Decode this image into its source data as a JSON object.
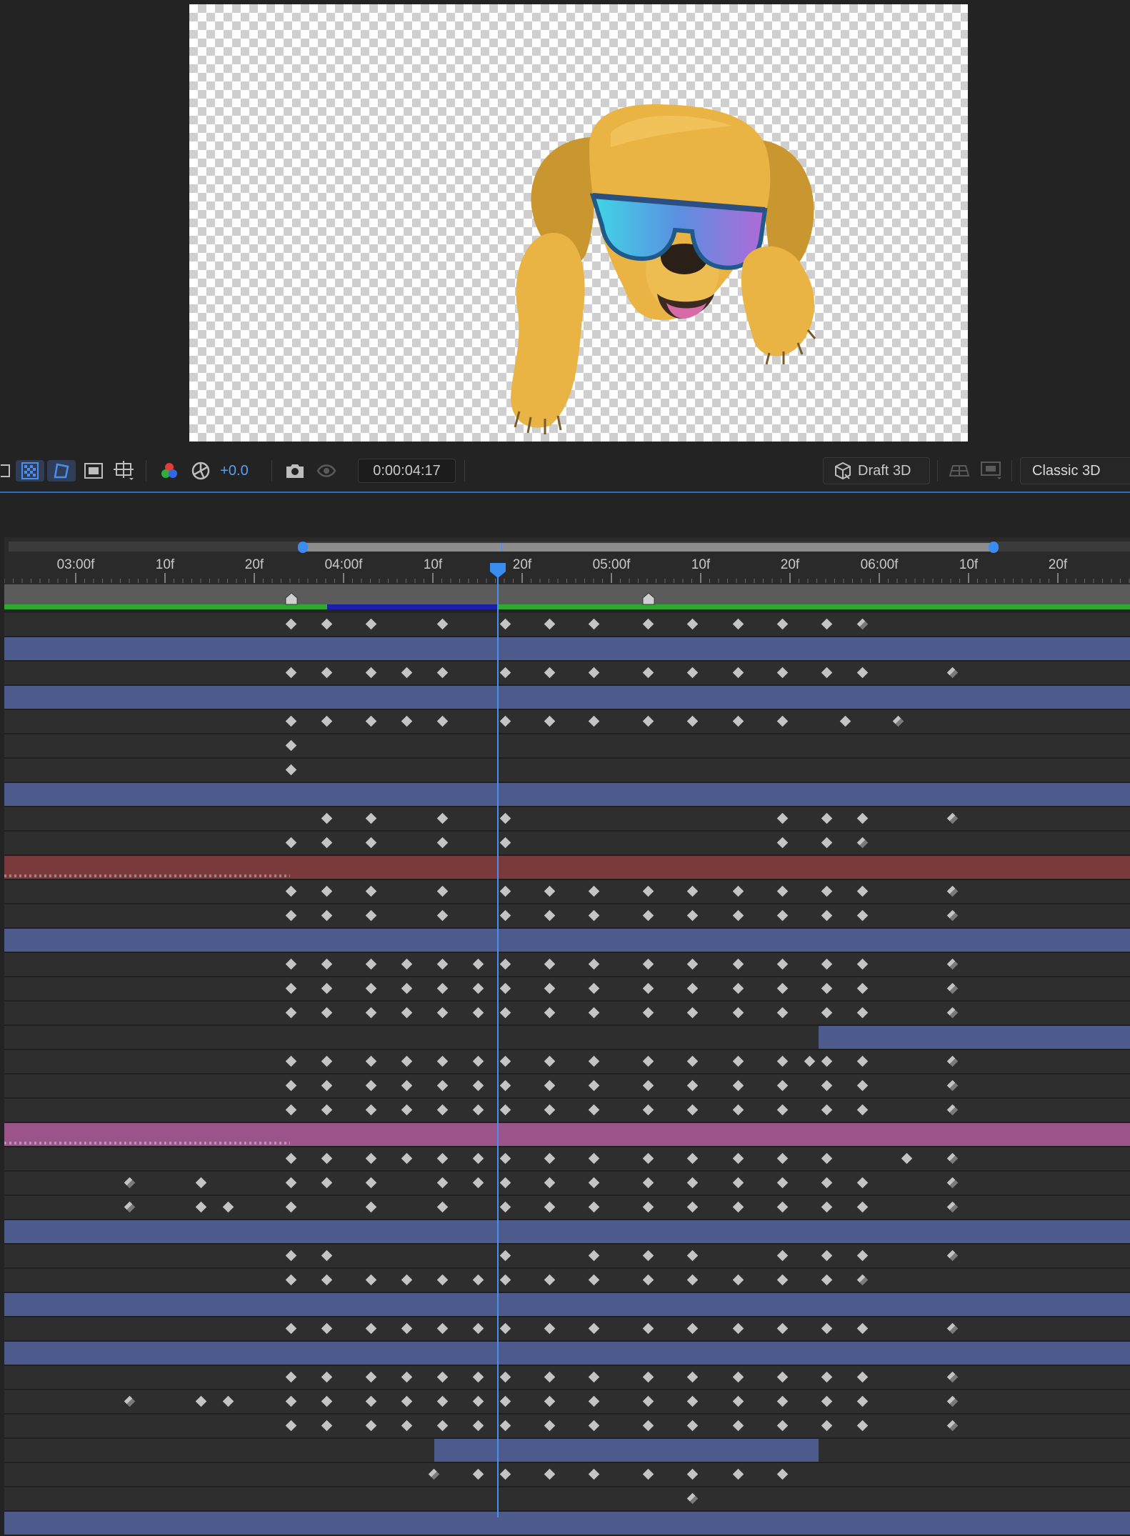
{
  "toolbar": {
    "exposure_value": "+0.0",
    "timecode": "0:00:04:17",
    "draft3d_label": "Draft 3D",
    "renderer_label": "Classic 3D",
    "accent_color": "#5a9ef0"
  },
  "timeline": {
    "ruler_labels": [
      "03:00f",
      "10f",
      "20f",
      "04:00f",
      "10f",
      "20f",
      "05:00f",
      "10f",
      "20f",
      "06:00f",
      "10f",
      "20f"
    ],
    "current_time": "0:00:04:17",
    "cache_color": "#2ea82e",
    "layer_bar_color": "#4c5a8c"
  },
  "icons": [
    "region-of-interest-icon",
    "transparency-grid-icon",
    "mask-path-icon",
    "safe-zone-icon",
    "grid-guides-icon",
    "rgb-channels-icon",
    "reset-exposure-icon",
    "snapshot-icon",
    "show-snapshot-icon",
    "draft3d-cube-icon",
    "3d-ground-plane-icon",
    "extended-viewer-icon"
  ]
}
